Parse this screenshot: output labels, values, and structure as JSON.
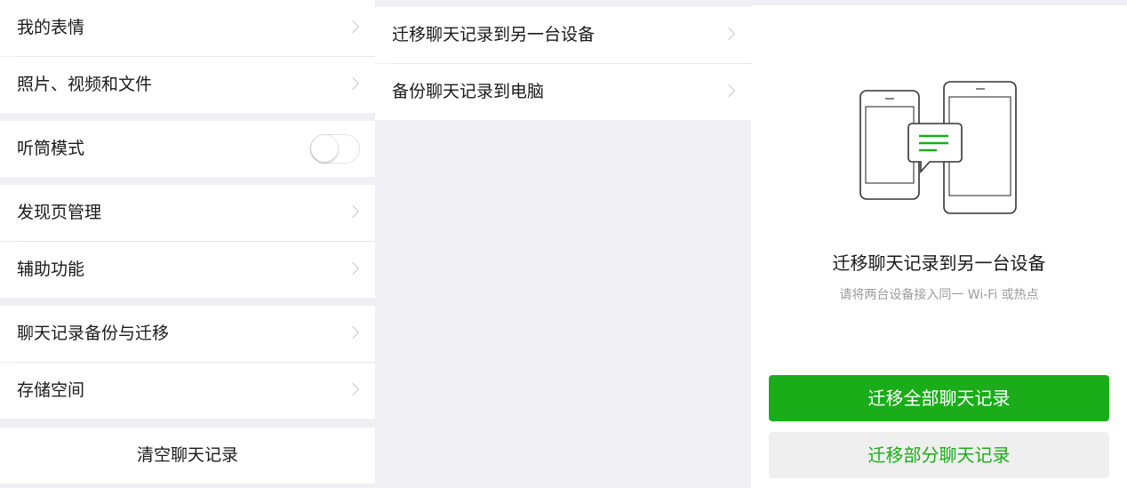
{
  "left_panel": {
    "items": {
      "stickers": "我的表情",
      "photos_files": "照片、视频和文件",
      "earpiece_mode": "听筒模式",
      "discover_manage": "发现页管理",
      "accessibility": "辅助功能",
      "backup_migrate": "聊天记录备份与迁移",
      "storage": "存储空间"
    },
    "earpiece_mode_on": false,
    "clear_history": "清空聊天记录"
  },
  "middle_panel": {
    "items": {
      "migrate_device": "迁移聊天记录到另一台设备",
      "backup_pc": "备份聊天记录到电脑"
    }
  },
  "right_panel": {
    "title": "迁移聊天记录到另一台设备",
    "subtitle": "请将两台设备接入同一 Wi-Fi 或热点",
    "primary_button": "迁移全部聊天记录",
    "secondary_button": "迁移部分聊天记录",
    "illustration_icon": "phone-transfer-icon"
  },
  "colors": {
    "accent_green": "#1aad19",
    "background_gray": "#efeff4"
  }
}
